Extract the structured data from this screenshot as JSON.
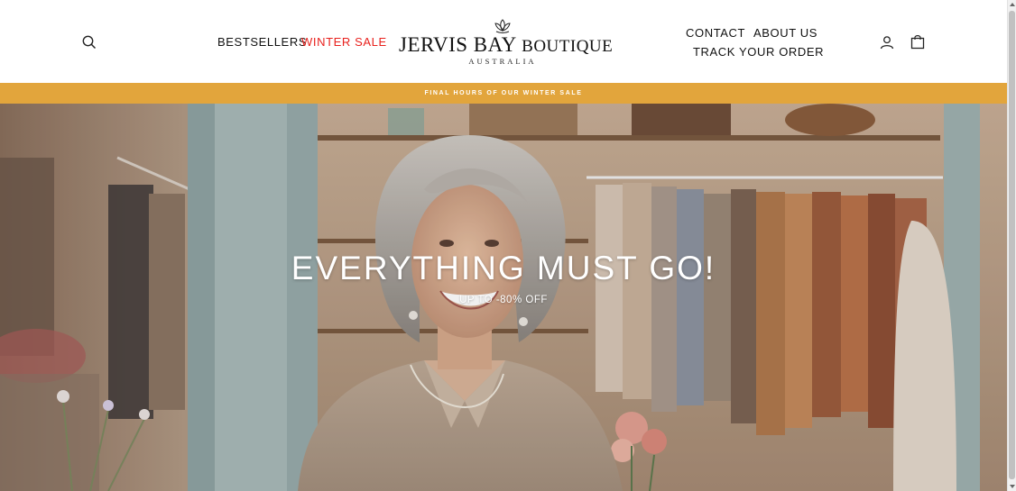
{
  "header": {
    "nav_left": [
      {
        "label": "BESTSELLERS"
      },
      {
        "label": "WINTER SALE"
      }
    ],
    "logo": {
      "title_part1": "JERVIS BAY",
      "title_part2": "BOUTIQUE",
      "subtitle": "AUSTRALIA"
    },
    "nav_right": [
      {
        "label": "CONTACT"
      },
      {
        "label": "ABOUT US"
      },
      {
        "label": "TRACK YOUR ORDER"
      }
    ],
    "icons": [
      "search-icon",
      "account-icon",
      "cart-icon"
    ]
  },
  "announcement": {
    "text": "FINAL HOURS OF OUR WINTER SALE",
    "background": "#e2a53c"
  },
  "hero": {
    "title": "EVERYTHING MUST GO!",
    "subtitle": "UP TO -80% OFF"
  },
  "colors": {
    "sale_link": "#e8211d",
    "accent_bar": "#e2a53c"
  }
}
